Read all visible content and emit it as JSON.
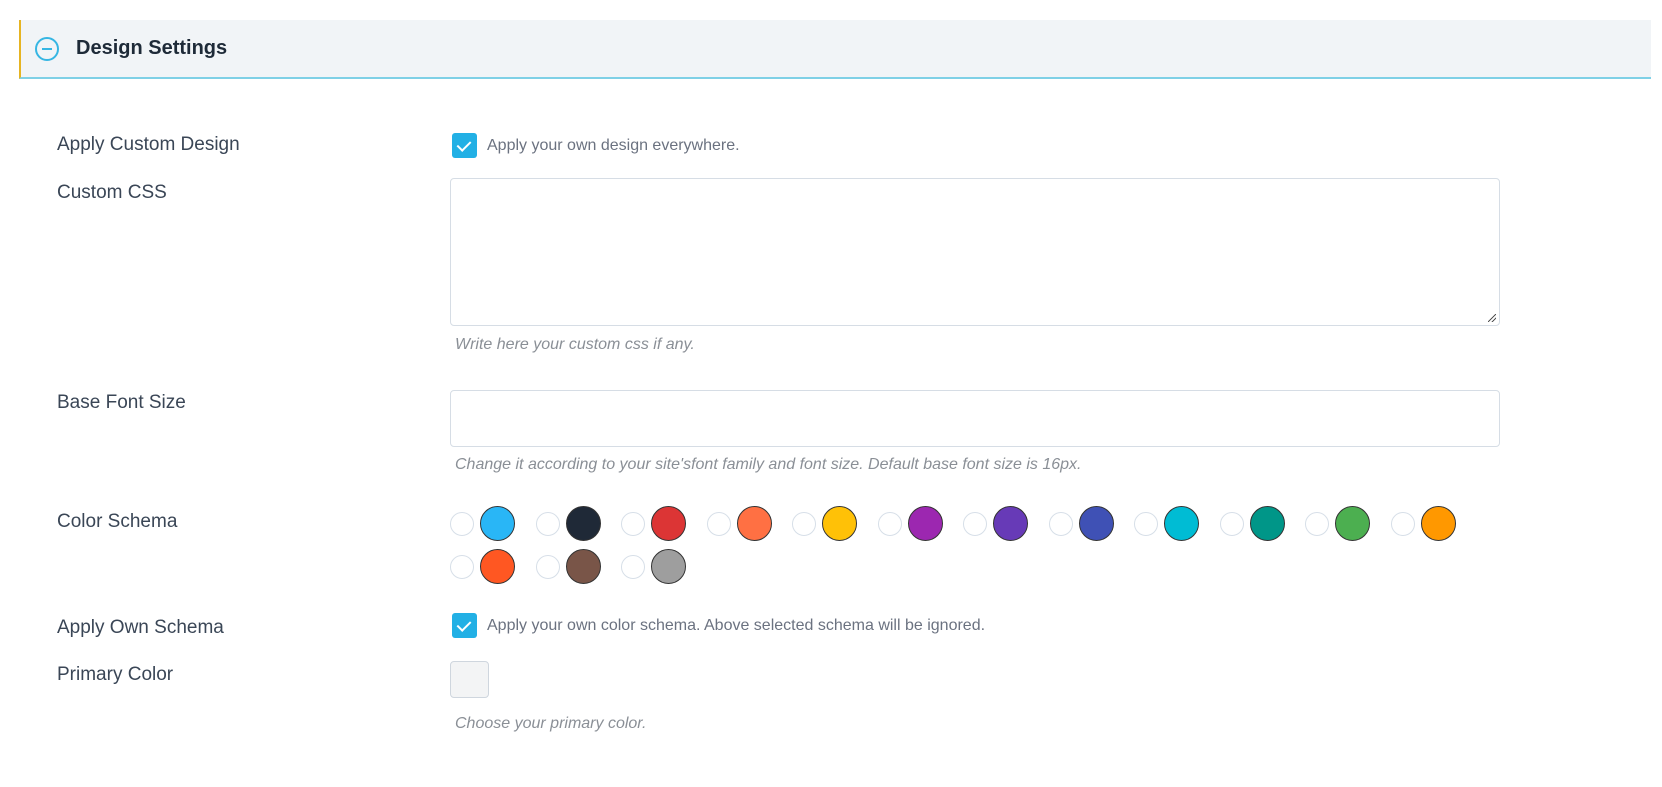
{
  "header": {
    "title": "Design Settings",
    "toggle_icon": "minus-circle-icon"
  },
  "fields": {
    "apply_custom_design": {
      "label": "Apply Custom Design",
      "checked": true,
      "text": "Apply your own design everywhere."
    },
    "custom_css": {
      "label": "Custom CSS",
      "value": "",
      "help": "Write here your custom css if any."
    },
    "base_font_size": {
      "label": "Base Font Size",
      "value": "",
      "help": "Change it according to your site'sfont family and font size. Default base font size is 16px."
    },
    "color_schema": {
      "label": "Color Schema",
      "options": [
        {
          "color": "#29b6f6"
        },
        {
          "color": "#1f2937"
        },
        {
          "color": "#dc3535"
        },
        {
          "color": "#ff7043"
        },
        {
          "color": "#ffc107"
        },
        {
          "color": "#9c27b0"
        },
        {
          "color": "#673ab7"
        },
        {
          "color": "#3f51b5"
        },
        {
          "color": "#00bcd4"
        },
        {
          "color": "#009688"
        },
        {
          "color": "#4caf50"
        },
        {
          "color": "#ff9800"
        },
        {
          "color": "#ff5722"
        },
        {
          "color": "#795548"
        },
        {
          "color": "#9e9e9e"
        }
      ]
    },
    "apply_own_schema": {
      "label": "Apply Own Schema",
      "checked": true,
      "text": "Apply your own color schema. Above selected schema will be ignored."
    },
    "primary_color": {
      "label": "Primary Color",
      "value": "#f3f4f5",
      "help": "Choose your primary color."
    }
  },
  "colors": {
    "accent": "#22b0e5",
    "header_bg": "#f1f4f7",
    "header_border": "#7fd0e6",
    "header_left_border": "#e6b422"
  }
}
